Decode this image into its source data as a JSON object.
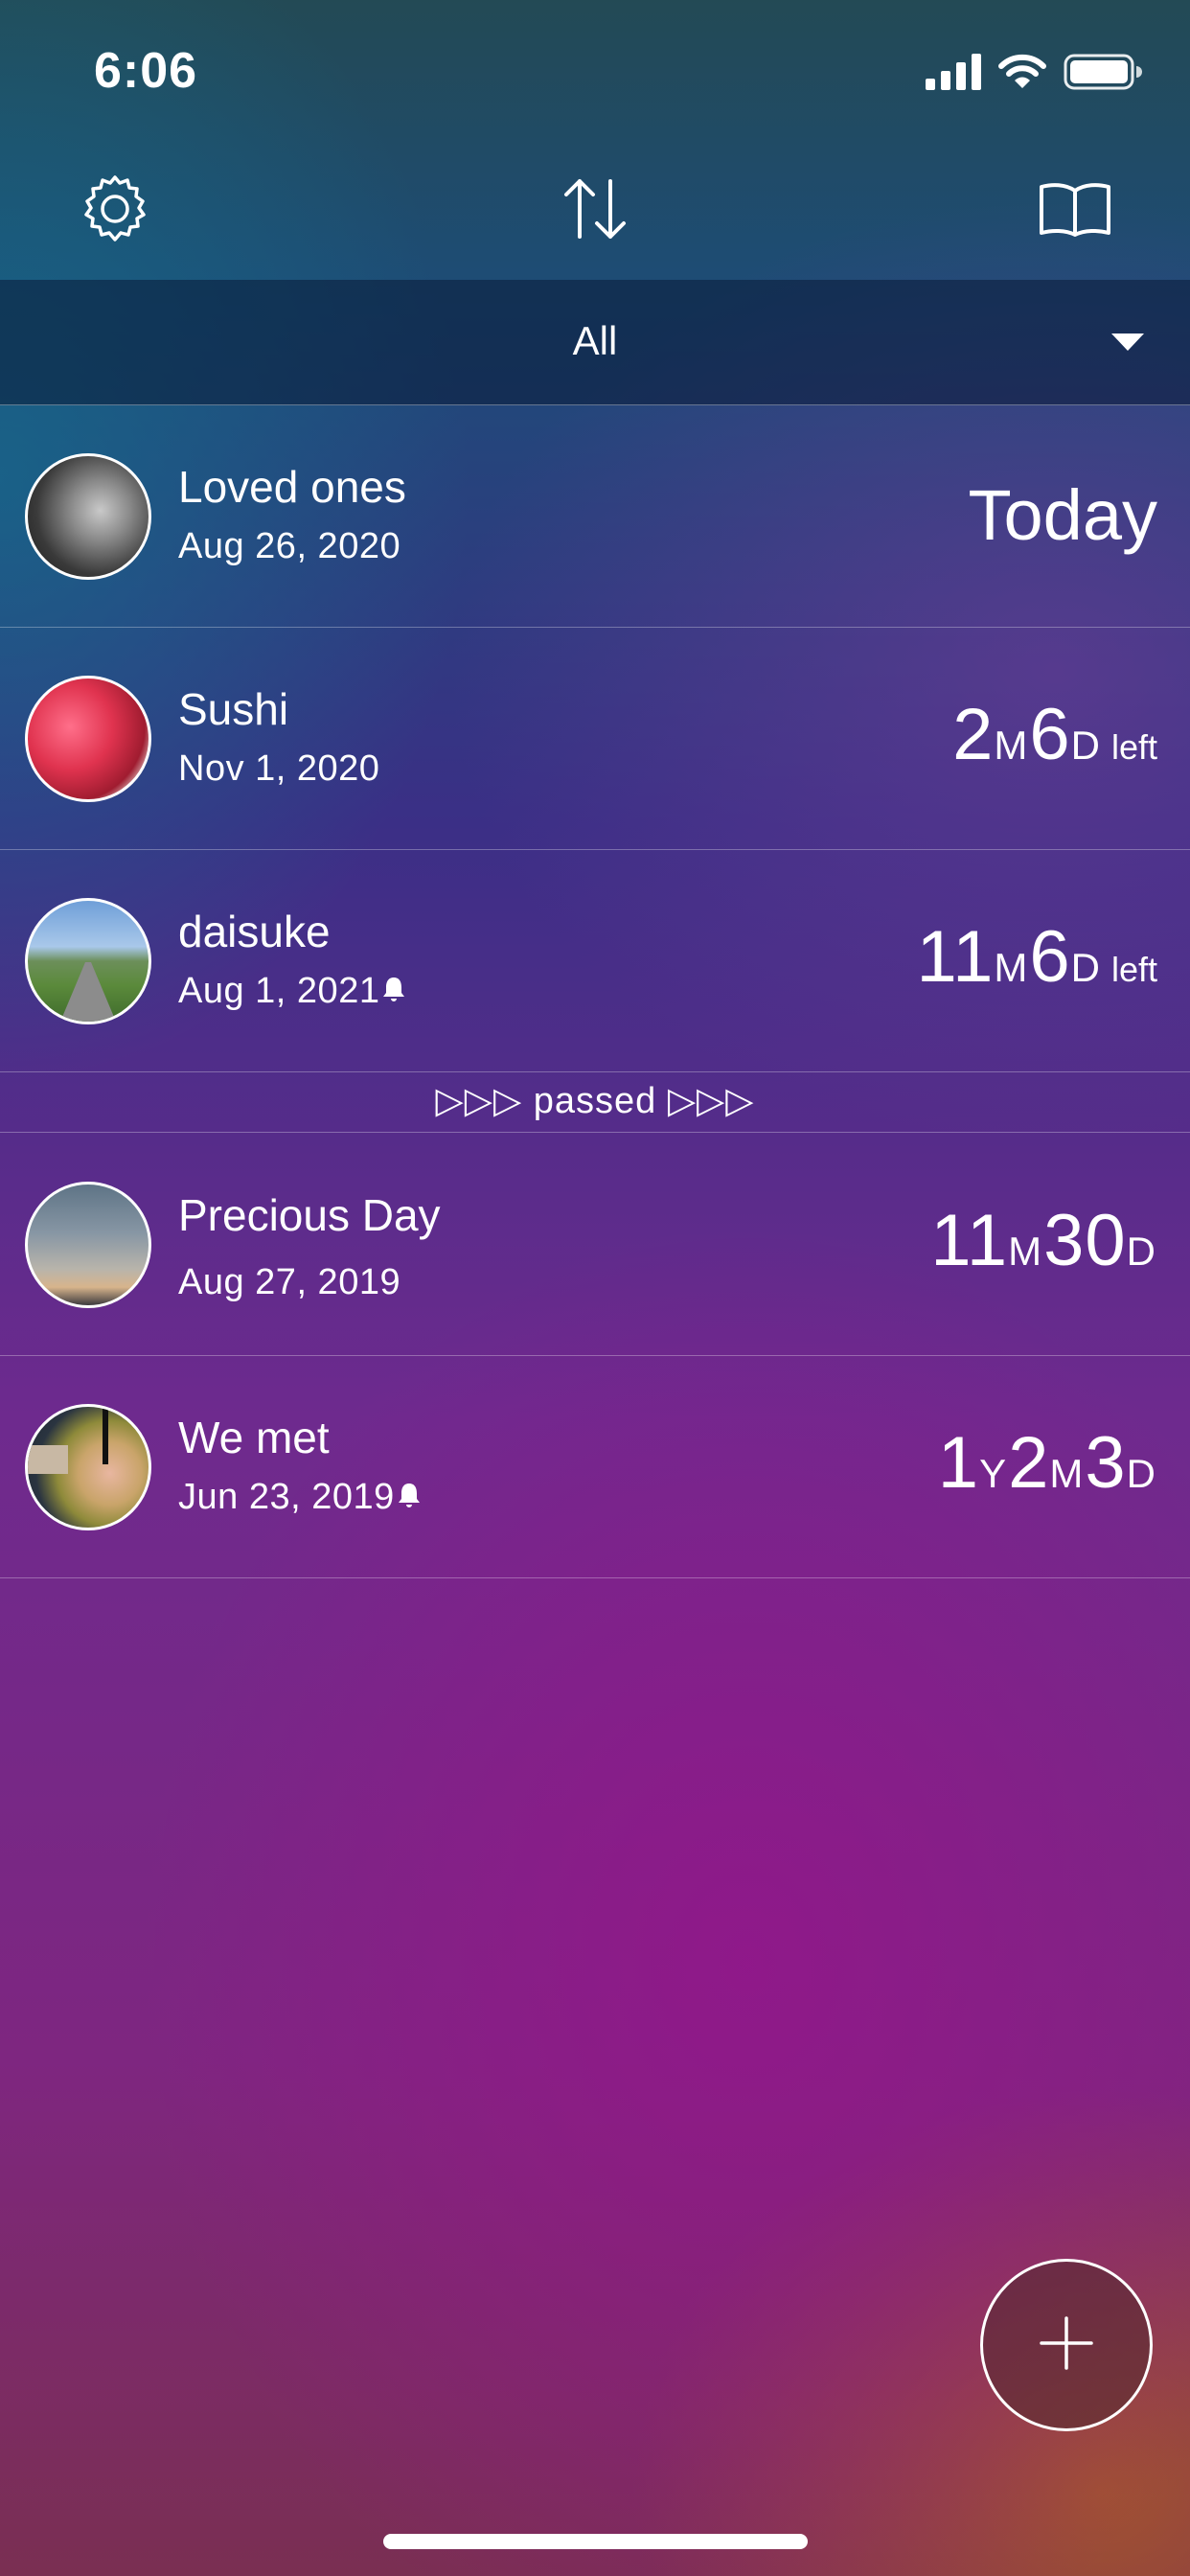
{
  "status_bar": {
    "time": "6:06"
  },
  "nav": {
    "settings_icon": "gear-icon",
    "sort_icon": "sort-arrows-icon",
    "book_icon": "open-book-icon"
  },
  "filter": {
    "selected": "All"
  },
  "events": [
    {
      "title": "Loved ones",
      "date": "Aug 26, 2020",
      "count": "Today"
    },
    {
      "title": "Sushi",
      "date": "Nov 1, 2020",
      "c1": "2",
      "u1": "M",
      "c2": "6",
      "u2": "D",
      "suffix": "left"
    },
    {
      "title": "daisuke",
      "date": "Aug 1, 2021",
      "c1": "11",
      "u1": "M",
      "c2": "6",
      "u2": "D",
      "suffix": "left",
      "reminder": true
    }
  ],
  "divider": {
    "label": "▷▷▷ passed ▷▷▷"
  },
  "past_events": [
    {
      "title": "Precious Day",
      "date": "Aug 27, 2019",
      "c1": "11",
      "u1": "M",
      "c2": "30",
      "u2": "D"
    },
    {
      "title": "We met",
      "date": "Jun 23, 2019",
      "c1": "1",
      "u1": "Y",
      "c2": "2",
      "u2": "M",
      "c3": "3",
      "u3": "D",
      "reminder": true
    }
  ],
  "fab": {
    "icon": "plus-icon"
  }
}
